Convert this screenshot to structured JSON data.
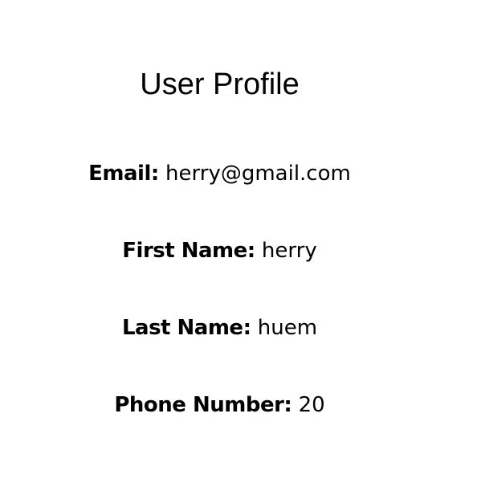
{
  "profile": {
    "title": "User Profile",
    "fields": [
      {
        "label": "Email:",
        "value": "herry@gmail.com"
      },
      {
        "label": "First Name:",
        "value": "herry"
      },
      {
        "label": "Last Name:",
        "value": "huem"
      },
      {
        "label": "Phone Number:",
        "value": "20"
      }
    ]
  }
}
